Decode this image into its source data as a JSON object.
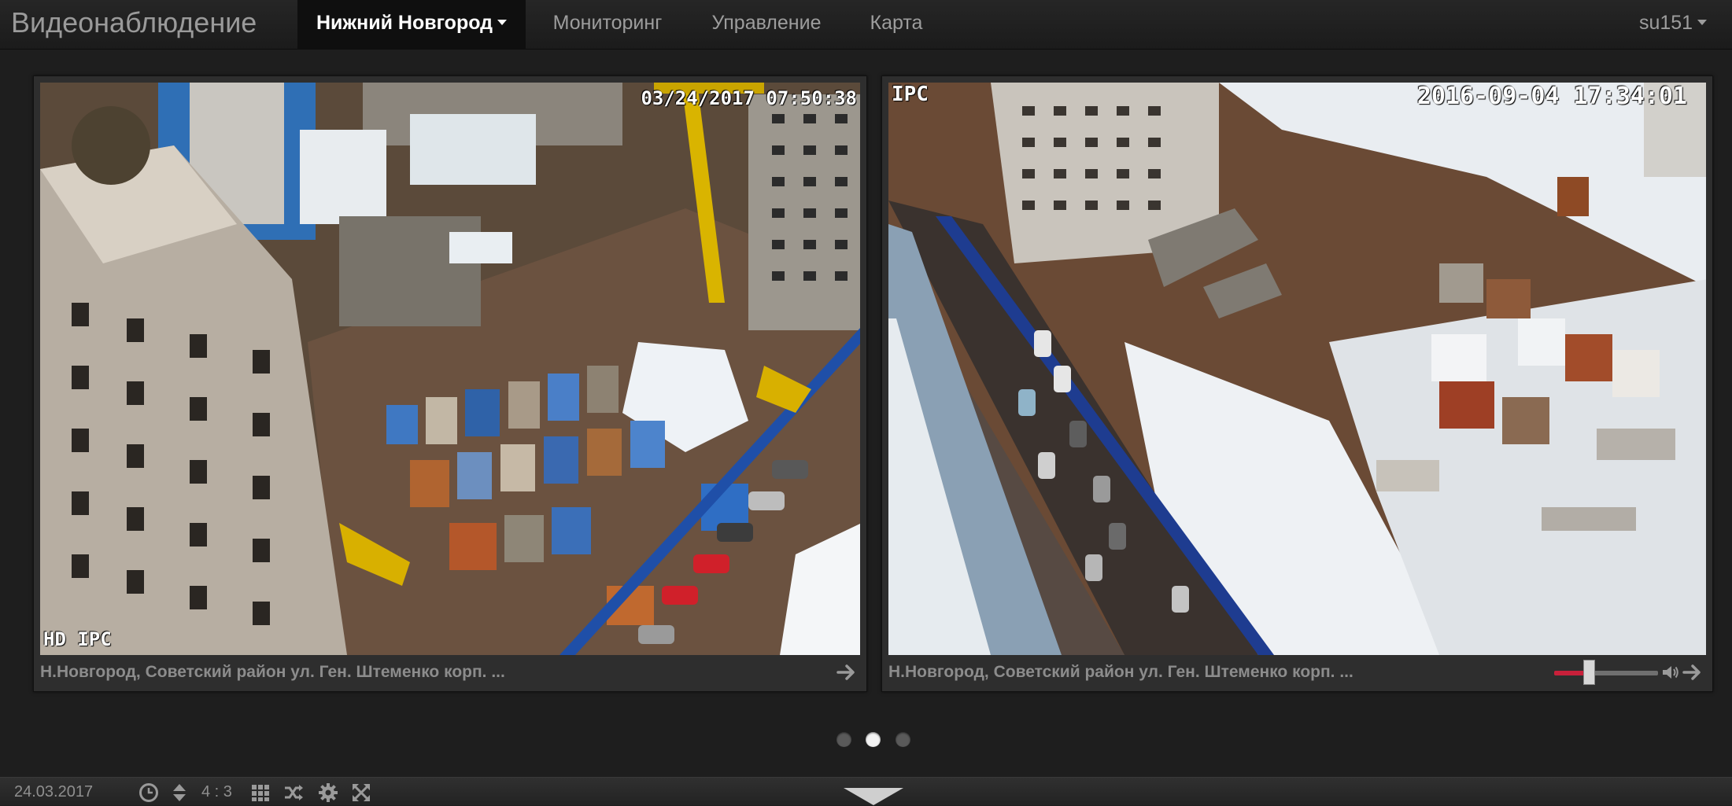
{
  "navbar": {
    "brand": "Видеонаблюдение",
    "items": [
      {
        "label": "Нижний Новгород",
        "active": true,
        "dropdown": true
      },
      {
        "label": "Мониторинг",
        "active": false
      },
      {
        "label": "Управление",
        "active": false
      },
      {
        "label": "Карта",
        "active": false
      }
    ],
    "user": "su151"
  },
  "cameras": [
    {
      "label": "Н.Новгород, Советский район ул. Ген. Штеменко корп. ...",
      "timestamp": "03/24/2017 07:50:38",
      "osd_corner": "HD IPC",
      "open_icon": "arrow-right-icon"
    },
    {
      "label": "Н.Новгород, Советский район ул. Ген. Штеменко корп. ...",
      "timestamp": "2016-09-04 17:34:01",
      "osd_corner": "IPC",
      "open_icon": "arrow-right-icon",
      "volume": 0.34
    }
  ],
  "carousel": {
    "pages": 3,
    "active_index": 1
  },
  "bottombar": {
    "date": "24.03.2017",
    "aspect": "4 : 3",
    "icons": [
      "clock-icon",
      "sort-arrows-icon",
      "grid-icon",
      "shuffle-icon",
      "gear-icon",
      "fullscreen-icon"
    ]
  },
  "colors": {
    "navbar_bg": "#222222",
    "active_nav_bg": "#0f0f0f",
    "page_bg": "#1e1e1e",
    "volume_accent": "#c8203a"
  }
}
